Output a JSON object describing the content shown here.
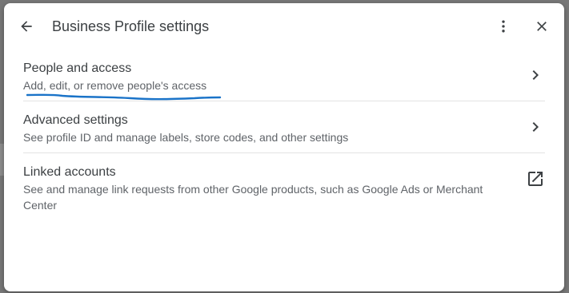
{
  "header": {
    "title": "Business Profile settings",
    "back_icon": "arrow-back-icon",
    "more_icon": "more-vert-icon",
    "close_icon": "close-icon"
  },
  "items": [
    {
      "title": "People and access",
      "description": "Add, edit, or remove people's access",
      "icon": "chevron-right-icon"
    },
    {
      "title": "Advanced settings",
      "description": "See profile ID and manage labels, store codes, and other settings",
      "icon": "chevron-right-icon"
    },
    {
      "title": "Linked accounts",
      "description": "See and manage link requests from other Google products, such as Google Ads or Merchant Center",
      "icon": "open-in-new-icon"
    }
  ],
  "colors": {
    "title_text": "#3c4043",
    "secondary_text": "#5f6368",
    "annotation_stroke": "#1a73c8",
    "divider": "#e3e3e3"
  }
}
